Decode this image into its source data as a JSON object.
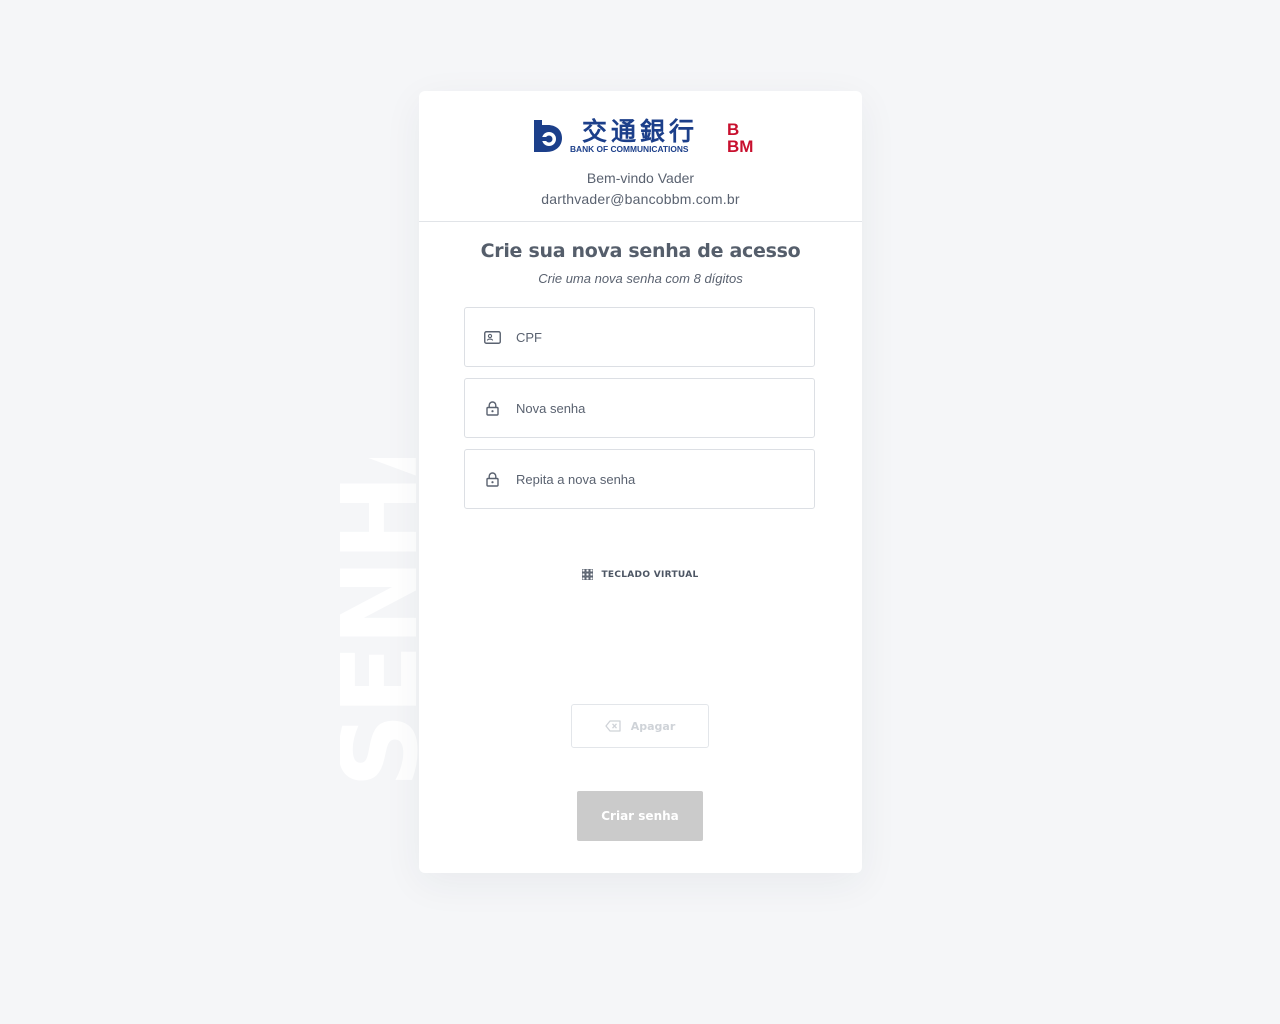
{
  "brand": {
    "logo_chinese": "交通銀行",
    "logo_english": "BANK OF COMMUNICATIONS",
    "logo_bbm_top": "B",
    "logo_bbm_bottom": "BM",
    "primary_color": "#1c3f8a",
    "bbm_color": "#c8102e"
  },
  "header": {
    "welcome": "Bem-vindo Vader",
    "email": "darthvader@bancobbm.com.br"
  },
  "watermark": {
    "text": "SENHA"
  },
  "form": {
    "title": "Crie sua nova senha de acesso",
    "subtitle": "Crie uma nova senha com 8 dígitos",
    "fields": [
      {
        "label": "CPF",
        "icon": "id-card-icon"
      },
      {
        "label": "Nova senha",
        "icon": "lock-icon"
      },
      {
        "label": "Repita a nova senha",
        "icon": "lock-icon"
      }
    ],
    "virtual_keyboard_label": "TECLADO VIRTUAL",
    "virtual_keyboard_icon": "keypad-icon",
    "erase_label": "Apagar",
    "erase_icon": "backspace-icon",
    "submit_label": "Criar senha",
    "submit_color": "#cbcbcb"
  }
}
